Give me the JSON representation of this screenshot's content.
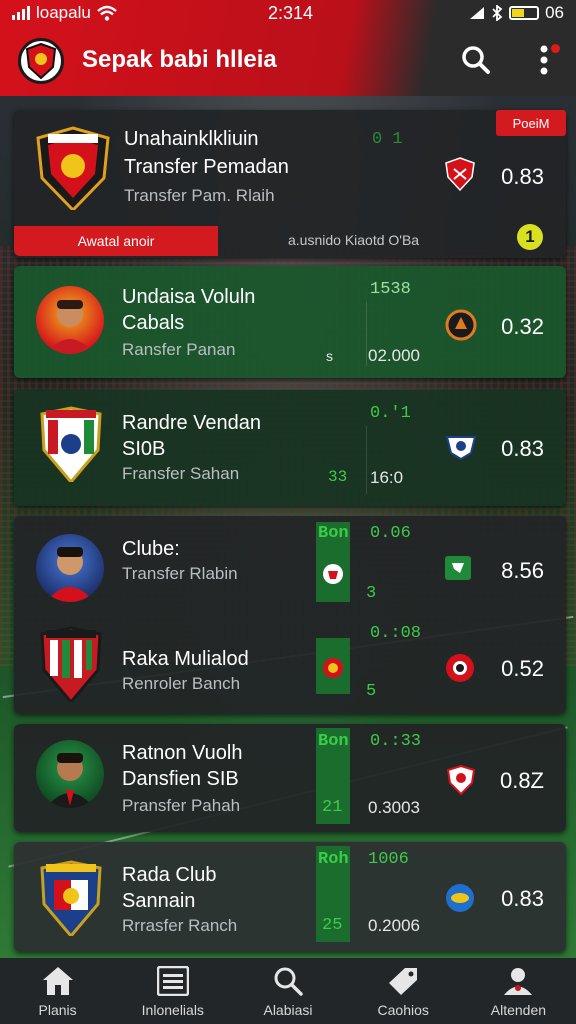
{
  "status_bar": {
    "carrier": "loapalu",
    "time": "2:314",
    "battery": "06"
  },
  "header": {
    "title": "Sepak babi hlleia",
    "icons": {
      "search": "search-icon",
      "more": "more-vertical-icon"
    }
  },
  "featured": {
    "name_line1": "Unahainklkliuin",
    "name_line2": "Transfer Pemadan",
    "subtitle": "Transfer Pam. Rlaih",
    "stat": "0 1",
    "tag": "PoeiM",
    "value": "0.83",
    "strip_left": "Awatal anoir",
    "strip_middle": "a.usnido Kiaotd O'Ba",
    "badge": "1"
  },
  "players": [
    {
      "name_line1": "Undaisa Voluln",
      "name_line2": "Cabals",
      "subtitle": "Ransfer Panan",
      "stat_top": "1538",
      "stat_small": "s",
      "stat_bottom": "02.000",
      "value": "0.32"
    },
    {
      "name_line1": "Randre Vendan",
      "name_line2": "SI0B",
      "subtitle": "Fransfer Sahan",
      "stat_top": "0.'1",
      "stat_small": "33",
      "stat_bottom": "16:0",
      "value": "0.83"
    },
    {
      "name_line1": "Clube:",
      "subtitle": "Transfer Rlabin",
      "stat_top_label": "Bon",
      "stat_top": "0.06",
      "stat_bottom": "3",
      "value": "8.56"
    },
    {
      "name_line1": "Raka Mulialod",
      "subtitle": "Renroler Banch",
      "stat_top": "0.:08",
      "stat_bottom": "5",
      "value": "0.52"
    },
    {
      "name_line1": "Ratnon Vuolh",
      "name_line2": "Dansfien  SIB",
      "subtitle": "Pransfer Pahah",
      "stat_top_label": "Bon",
      "stat_top": "0.:33",
      "stat_small": "21",
      "stat_bottom": "0.3003",
      "value": "0.8Z"
    },
    {
      "name_line1": "Rada Club",
      "name_line2": "Sannain",
      "subtitle": "Rrrasfer Ranch",
      "stat_top_label": "Roh",
      "stat_top": "1006",
      "stat_small": "25",
      "stat_bottom": "0.2006",
      "value": "0.83"
    }
  ],
  "bottom_nav": [
    {
      "label": "Planis",
      "icon": "home-icon"
    },
    {
      "label": "Inlonelials",
      "icon": "list-icon"
    },
    {
      "label": "Alabiasi",
      "icon": "search-icon"
    },
    {
      "label": "Caohios",
      "icon": "tag-icon"
    },
    {
      "label": "Altenden",
      "icon": "profile-icon"
    }
  ],
  "colors": {
    "brand_red": "#d4111b",
    "accent_green": "#3ccb4a",
    "card_dark": "#222426",
    "card_green": "#1a562c"
  }
}
